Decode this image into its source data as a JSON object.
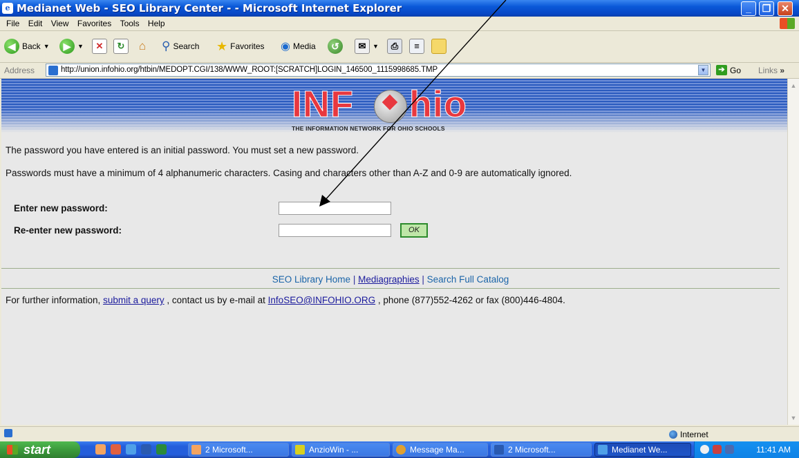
{
  "window": {
    "title": "Medianet Web - SEO Library Center - - Microsoft Internet Explorer",
    "minimize": "_",
    "maximize": "❐",
    "close": "✕"
  },
  "menu": [
    "File",
    "Edit",
    "View",
    "Favorites",
    "Tools",
    "Help"
  ],
  "toolbar": {
    "back": "Back",
    "search": "Search",
    "favorites": "Favorites",
    "media": "Media"
  },
  "address": {
    "label": "Address",
    "url": "http://union.infohio.org/htbin/MEDOPT.CGI/138/WWW_ROOT:[SCRATCH]LOGIN_146500_1115998685.TMP",
    "go": "Go",
    "links": "Links"
  },
  "page": {
    "logo_text": "INF",
    "logo_text2": "hio",
    "logo_tagline": "THE INFORMATION NETWORK FOR OHIO SCHOOLS",
    "message1": "The password you have entered is an initial password. You must set a new password.",
    "message2": "Passwords must have a minimum of 4 alphanumeric characters. Casing and characters other than A-Z and 0-9 are automatically ignored.",
    "new_password_label": "Enter new password:",
    "reenter_password_label": "Re-enter new password:",
    "new_password_value": "",
    "reenter_password_value": "",
    "ok_label": "OK",
    "footer_links": [
      "SEO Library Home",
      "Mediagraphies",
      "Search Full Catalog"
    ],
    "footer_sep": " | ",
    "info_prefix": "For further information, ",
    "info_link1": "submit a query",
    "info_middle": " , contact us by e-mail at ",
    "info_link2": "InfoSEO@INFOHIO.ORG",
    "info_suffix": " , phone (877)552-4262 or fax (800)446-4804."
  },
  "status": {
    "zone": "Internet"
  },
  "taskbar": {
    "start": "start",
    "tasks": [
      "2 Microsoft...",
      "AnzioWin - ...",
      "Message Ma...",
      "2 Microsoft...",
      "Medianet We..."
    ],
    "clock": "11:41 AM"
  },
  "colors": {
    "titlebar": "#0a58d8",
    "taskbar": "#245edb",
    "link": "#1a1a9c",
    "logo_red": "#e8383f",
    "ok_border": "#2c8a2c"
  },
  "icons": [
    "back-icon",
    "forward-icon",
    "stop-icon",
    "refresh-icon",
    "home-icon",
    "search-icon",
    "favorites-icon",
    "media-icon",
    "history-icon",
    "mail-icon",
    "print-icon",
    "edit-icon",
    "folder-icon",
    "earth-icon"
  ]
}
